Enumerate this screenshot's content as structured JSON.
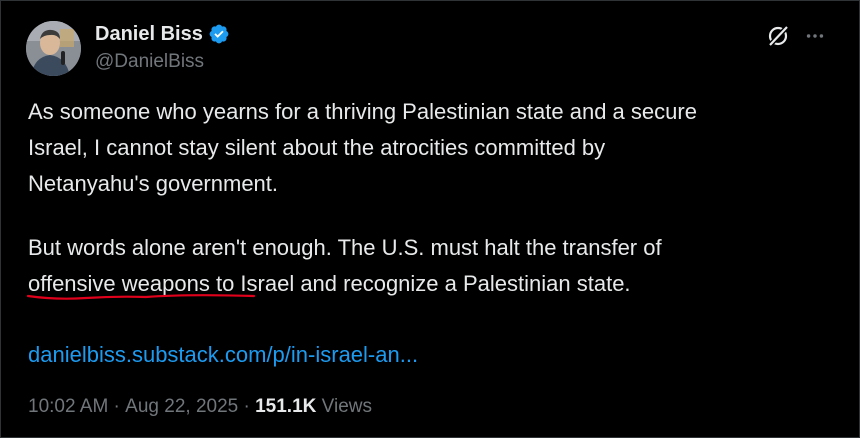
{
  "author": {
    "display_name": "Daniel Biss",
    "handle": "@DanielBiss",
    "verified": true,
    "avatar_icon": "profile-photo"
  },
  "header_actions": {
    "grok_icon": "grok-icon",
    "more_icon": "more-icon"
  },
  "tweet": {
    "paragraph1_lines": [
      "As someone who yearns for a thriving Palestinian state and a secure",
      "Israel, I cannot stay silent about the atrocities committed by",
      "Netanyahu's government."
    ],
    "paragraph2_line1": "But words alone aren't enough. The U.S. must halt the transfer of",
    "paragraph2_line2_underlined": "offensive weapons",
    "paragraph2_line2_rest": " to Israel and recognize a Palestinian state.",
    "link": "danielbiss.substack.com/p/in-israel-an..."
  },
  "meta": {
    "time": "10:02 AM",
    "separator": " · ",
    "date": "Aug 22, 2025",
    "views_count": "151.1K",
    "views_label": " Views"
  },
  "colors": {
    "background": "#000000",
    "text": "#e7e9ea",
    "muted": "#71767b",
    "link": "#1d9bf0",
    "verified": "#1d9bf0",
    "annotation": "#e0001b"
  }
}
